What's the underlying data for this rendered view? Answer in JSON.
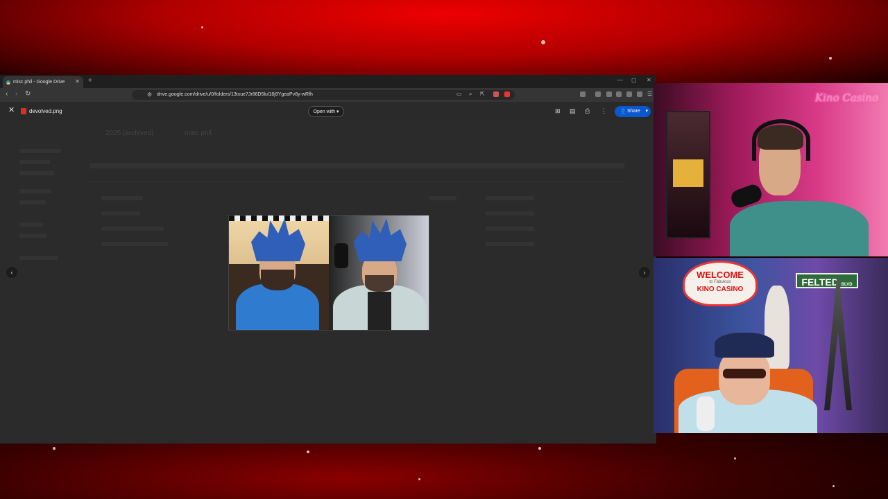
{
  "browser": {
    "tab_title": "misc phil - Google Drive",
    "new_tab": "+",
    "address": "drive.google.com/drive/u/0/folders/13txue7Jr86D5lul18j9YgeaPv8y-wRfh"
  },
  "viewer": {
    "filename": "devolved.png",
    "open_with_label": "Open with",
    "share_label": "Share"
  },
  "background_page": {
    "breadcrumb_root": "2025 (archived)",
    "breadcrumb_current": "misc phil"
  },
  "streamers": {
    "top_cam_sign": "Kino Casino",
    "bottom_sign_welcome": "WELCOME",
    "bottom_sign_to": "to Fabulous",
    "bottom_sign_name": "KINO CASINO",
    "street_sign": "FELTED",
    "street_sign_suffix": "BLVD"
  },
  "colors": {
    "share_blue": "#0b57d0",
    "stage_red": "#c40000",
    "viewer_bg": "#2b2b2b"
  }
}
